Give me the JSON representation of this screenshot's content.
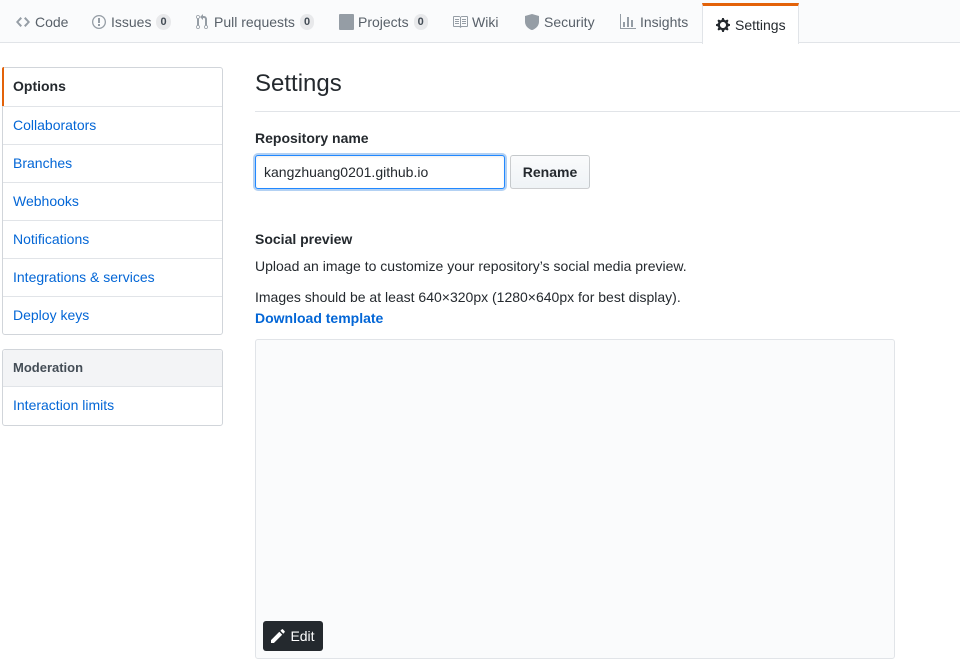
{
  "tabs": {
    "code": {
      "label": "Code",
      "icon": "code-icon"
    },
    "issues": {
      "label": "Issues",
      "count": "0",
      "icon": "issue-opened-icon"
    },
    "pulls": {
      "label": "Pull requests",
      "count": "0",
      "icon": "git-pull-request-icon"
    },
    "projects": {
      "label": "Projects",
      "count": "0",
      "icon": "project-icon"
    },
    "wiki": {
      "label": "Wiki",
      "icon": "book-icon"
    },
    "security": {
      "label": "Security",
      "icon": "shield-icon"
    },
    "insights": {
      "label": "Insights",
      "icon": "graph-icon"
    },
    "settings": {
      "label": "Settings",
      "icon": "gear-icon",
      "selected": true
    }
  },
  "sidebar": {
    "items": [
      {
        "label": "Options",
        "selected": true
      },
      {
        "label": "Collaborators"
      },
      {
        "label": "Branches"
      },
      {
        "label": "Webhooks"
      },
      {
        "label": "Notifications"
      },
      {
        "label": "Integrations & services"
      },
      {
        "label": "Deploy keys"
      }
    ],
    "moderation": {
      "heading": "Moderation",
      "items": [
        {
          "label": "Interaction limits"
        }
      ]
    }
  },
  "main": {
    "title": "Settings",
    "repo_name_label": "Repository name",
    "repo_name_value": "kangzhuang0201.github.io",
    "rename_button": "Rename",
    "social_heading": "Social preview",
    "social_desc": "Upload an image to customize your repository’s social media preview.",
    "social_size_note": "Images should be at least 640×320px (1280×640px for best display).",
    "download_template": "Download template",
    "edit_button": "Edit"
  },
  "colors": {
    "accent": "#e36209",
    "link": "#0366d6",
    "text": "#24292e"
  }
}
